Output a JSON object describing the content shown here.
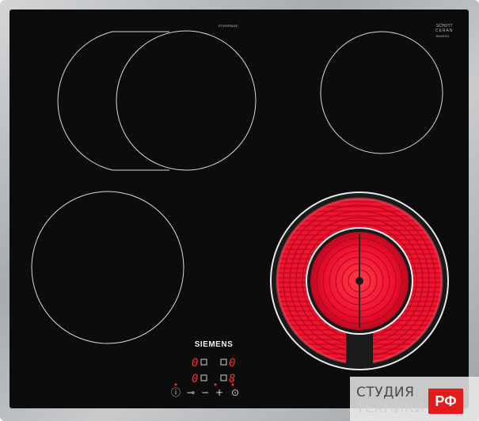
{
  "hob": {
    "model_code": "ET645FBA1E",
    "glass_brand_top": "SCHOTT",
    "glass_brand_bottom": "CERAN",
    "glass_code": "B040010",
    "brand": "SIEMENS"
  },
  "controls": {
    "left_display": "0",
    "right_display": "0",
    "lower_left_display": "0",
    "lower_right_display": "8",
    "power_symbol": "ⓘ",
    "lock_symbol": "⊸",
    "minus_symbol": "−",
    "plus_symbol": "+",
    "timer_symbol": "⊙"
  },
  "watermark": {
    "line1": "СТУДИЯ",
    "line2": "ТЕХНИКИ",
    "badge": "РФ"
  },
  "colors": {
    "glass": "#0c0c0c",
    "frame": "#b9bcbe",
    "heat": "#e8102b",
    "badge": "#e41b1b"
  }
}
